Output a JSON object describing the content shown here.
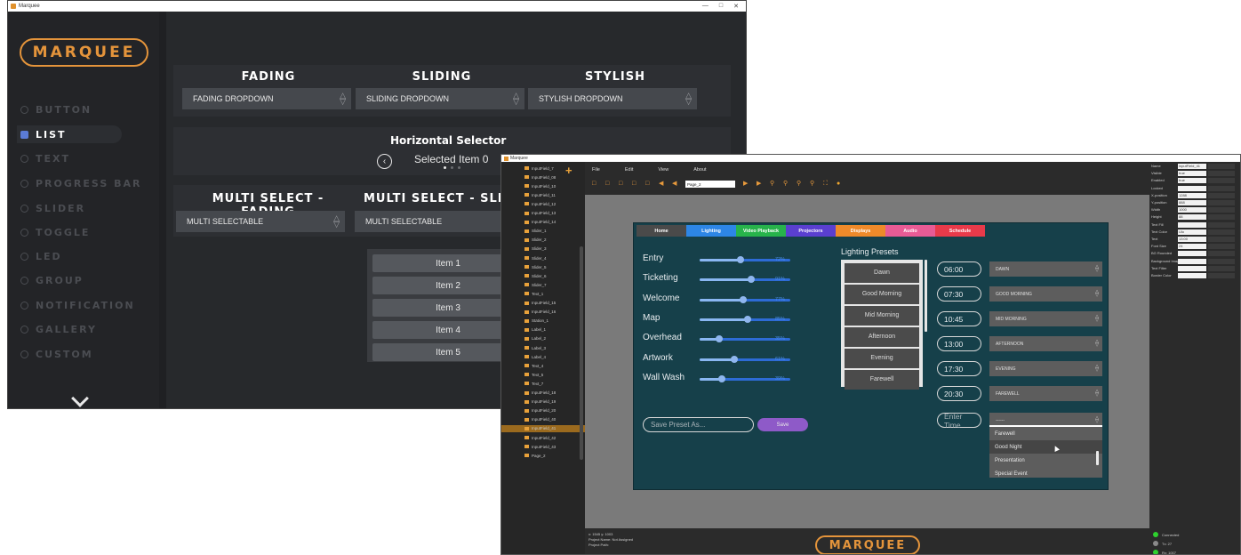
{
  "win1": {
    "title": "Marquee",
    "logo": "MARQUEE",
    "nav": [
      {
        "label": "BUTTON",
        "icon": "button-icon"
      },
      {
        "label": "LIST",
        "icon": "list-icon",
        "active": true
      },
      {
        "label": "TEXT",
        "icon": "text-icon"
      },
      {
        "label": "PROGRESS BAR",
        "icon": "progress-icon"
      },
      {
        "label": "SLIDER",
        "icon": "slider-icon"
      },
      {
        "label": "TOGGLE",
        "icon": "toggle-icon"
      },
      {
        "label": "LED",
        "icon": "led-icon"
      },
      {
        "label": "GROUP",
        "icon": "group-icon"
      },
      {
        "label": "NOTIFICATION",
        "icon": "notification-icon"
      },
      {
        "label": "GALLERY",
        "icon": "gallery-icon"
      },
      {
        "label": "CUSTOM",
        "icon": "custom-icon"
      }
    ],
    "headers": {
      "fading": "FADING",
      "sliding": "SLIDING",
      "stylish": "STYLISH"
    },
    "dropdowns": {
      "fading": "FADING DROPDOWN",
      "sliding": "SLIDING DROPDOWN",
      "stylish": "STYLISH DROPDOWN"
    },
    "hsel": {
      "title": "Horizontal Selector",
      "value": "Selected Item 0"
    },
    "multi": {
      "fading": "MULTI SELECT - FADING",
      "sliding": "MULTI SELECT - SLI",
      "fading_value": "MULTI SELECTABLE",
      "sliding_value": "MULTI SELECTABLE"
    },
    "items": [
      "Item 1",
      "Item 2",
      "Item 3",
      "Item 4",
      "Item 5"
    ]
  },
  "win2": {
    "title": "Marquee",
    "menu": [
      "File",
      "Edit",
      "View",
      "About"
    ],
    "page_select": "Page_2",
    "tree": [
      "InputField_7",
      "InputField_08",
      "InputField_10",
      "InputField_11",
      "InputField_12",
      "InputField_13",
      "InputField_14",
      "Slider_1",
      "Slider_2",
      "Slider_3",
      "Slider_4",
      "Slider_5",
      "Slider_6",
      "Slider_7",
      "Text_1",
      "InputField_15",
      "InputField_16",
      "Station_1",
      "Label_1",
      "Label_2",
      "Label_3",
      "Label_4",
      "Text_4",
      "Text_5",
      "Text_7",
      "InputField_18",
      "InputField_19",
      "InputField_20",
      "InputField_40",
      "InputField_41",
      "InputField_42",
      "InputField_43",
      "Page_2"
    ],
    "tree_selected": 29,
    "status": [
      "x: 1545 y: 1003",
      "Project Name: Not Assigned",
      "Project Path:"
    ],
    "logo": "MARQUEE",
    "props": [
      {
        "label": "Name",
        "value": "inputField_41"
      },
      {
        "label": "Visible",
        "value": "true"
      },
      {
        "label": "Enabled",
        "value": "true"
      },
      {
        "label": "Locked",
        "value": ""
      },
      {
        "label": "X-position",
        "value": "1288"
      },
      {
        "label": "Y-position",
        "value": "888"
      },
      {
        "label": "Width",
        "value": "1000"
      },
      {
        "label": "Height",
        "value": "88"
      },
      {
        "label": "Text Fill",
        "value": ""
      },
      {
        "label": "Text Color",
        "value": "Ulo"
      },
      {
        "label": "Text",
        "value": "13:00"
      },
      {
        "label": "Font Size",
        "value": "24"
      },
      {
        "label": "BG Rounded",
        "value": ""
      },
      {
        "label": "Background Image",
        "value": ""
      },
      {
        "label": "Text Filter",
        "value": ""
      },
      {
        "label": "Border Color",
        "value": ""
      }
    ],
    "connection": [
      {
        "label": "Connected",
        "color": "#2ed12e"
      },
      {
        "label": "Tx: 27",
        "color": "#8a8a8a"
      },
      {
        "label": "Rx: 1007",
        "color": "#2ed12e"
      }
    ],
    "app": {
      "tabs": [
        {
          "label": "Home",
          "color": "#4a4a4a"
        },
        {
          "label": "Lighting",
          "color": "#2d86e6"
        },
        {
          "label": "Video Playback",
          "color": "#27b34b"
        },
        {
          "label": "Projectors",
          "color": "#5a3fd0"
        },
        {
          "label": "Displays",
          "color": "#ee8a2a"
        },
        {
          "label": "Audio",
          "color": "#e85b95"
        },
        {
          "label": "Schedule",
          "color": "#e83a4a"
        }
      ],
      "sliders": [
        {
          "label": "Entry",
          "value": 72,
          "pct": "72%"
        },
        {
          "label": "Ticketing",
          "value": 91,
          "pct": "91%"
        },
        {
          "label": "Welcome",
          "value": 77,
          "pct": "77%"
        },
        {
          "label": "Map",
          "value": 85,
          "pct": "85%"
        },
        {
          "label": "Overhead",
          "value": 35,
          "pct": "35%"
        },
        {
          "label": "Artwork",
          "value": 61,
          "pct": "61%"
        },
        {
          "label": "Wall Wash",
          "value": 39,
          "pct": "39%"
        }
      ],
      "presets_title": "Lighting Presets",
      "presets": [
        "Dawn",
        "Good Morning",
        "Mid Morning",
        "Afternoon",
        "Evening",
        "Farewell"
      ],
      "schedule": [
        {
          "time": "06:00",
          "preset": "DAWN"
        },
        {
          "time": "07:30",
          "preset": "GOOD MORNING"
        },
        {
          "time": "10:45",
          "preset": "MID MORNING"
        },
        {
          "time": "13:00",
          "preset": "AFTERNOON"
        },
        {
          "time": "17:30",
          "preset": "EVENING"
        },
        {
          "time": "20:30",
          "preset": "FAREWELL"
        }
      ],
      "time_placeholder": "Enter Time",
      "open_dropdown_value": "------",
      "open_list": [
        "Farewell",
        "Good Night",
        "Presentation",
        "Special Event"
      ],
      "open_list_highlight": 1,
      "save_placeholder": "Save Preset As...",
      "save_label": "Save"
    }
  }
}
